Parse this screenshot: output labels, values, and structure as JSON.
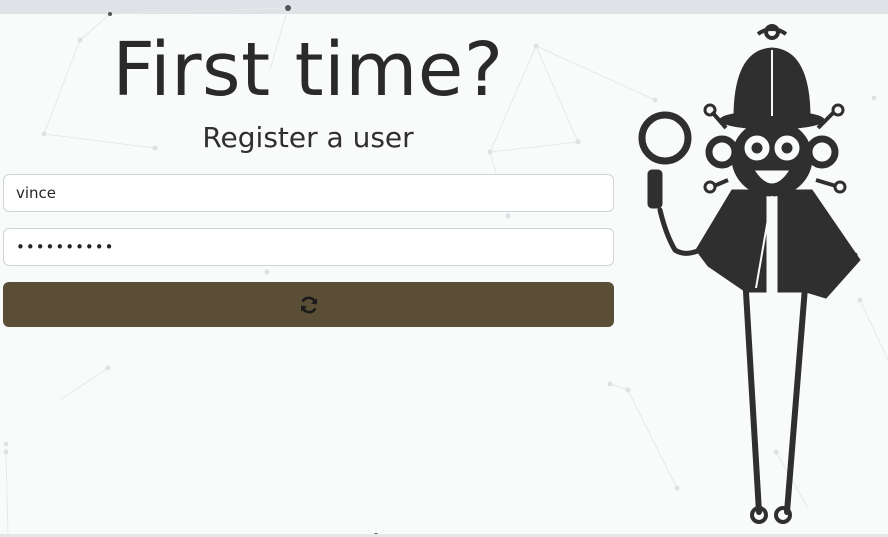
{
  "register": {
    "headline": "First time?",
    "subheadline": "Register a user",
    "username_value": "vince",
    "password_value": "••••••••••",
    "submit_icon": "refresh-icon"
  },
  "mascot": {
    "icon": "detective-monkey-mascot"
  },
  "colors": {
    "button": "#5a4e36",
    "background": "#f9fafa",
    "topbar": "#dfe2e6",
    "mascot": "#2f2f2f"
  }
}
